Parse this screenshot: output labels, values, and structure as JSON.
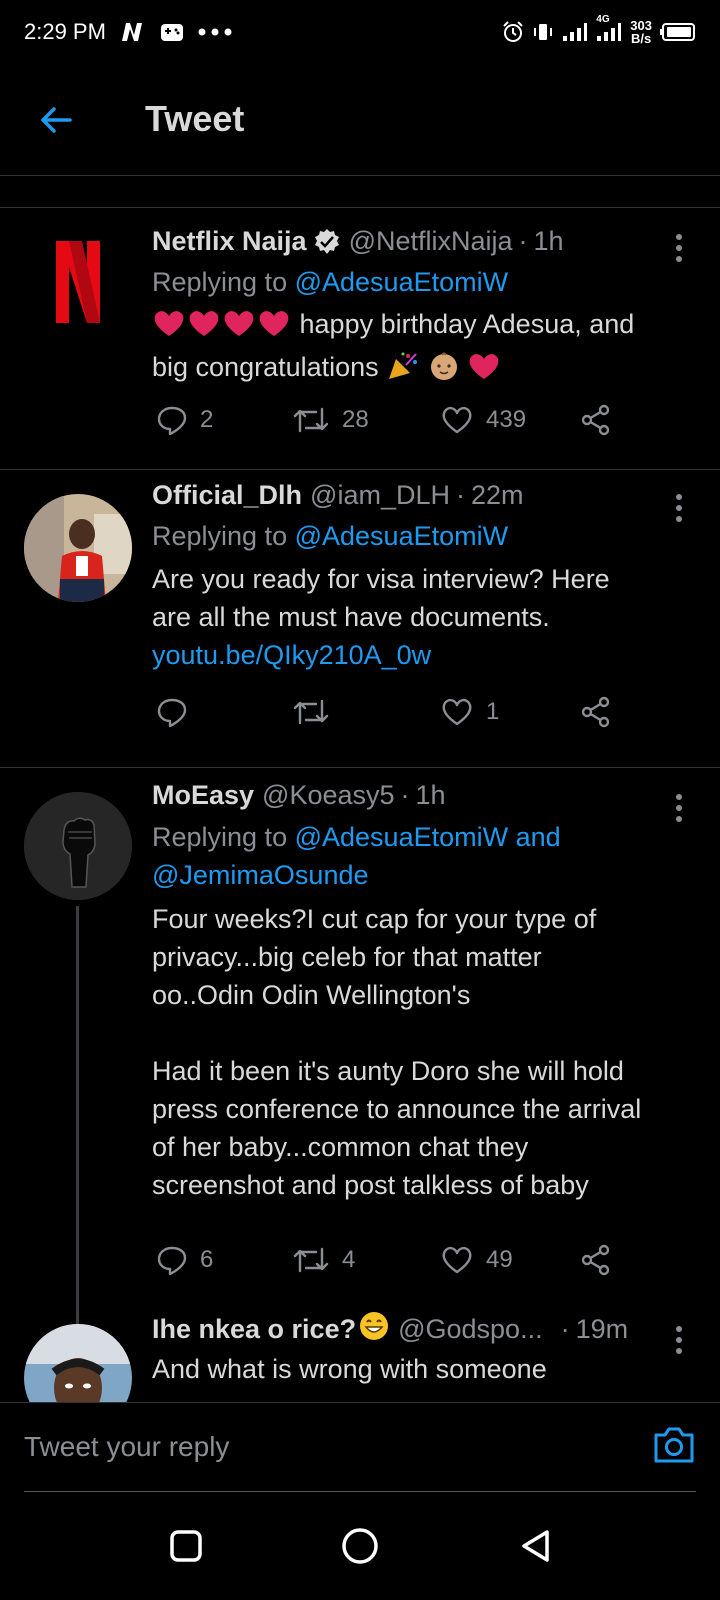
{
  "status_bar": {
    "time": "2:29 PM",
    "net_speed_value": "303",
    "net_speed_unit": "B/s",
    "network_label": "4G"
  },
  "header": {
    "title": "Tweet"
  },
  "tweets": [
    {
      "name": "Netflix Naija",
      "verified": true,
      "handle": "@NetflixNaija",
      "time": "1h",
      "replying_prefix": "Replying to",
      "replying_to": "@AdesuaEtomiW",
      "text_1": "happy birthday Adesua, and",
      "text_2": "big congratulations",
      "replies": "2",
      "retweets": "28",
      "likes": "439"
    },
    {
      "name": "Official_Dlh",
      "handle": "@iam_DLH",
      "time": "22m",
      "replying_prefix": "Replying to",
      "replying_to": "@AdesuaEtomiW",
      "text_1": "Are you ready for visa interview? Here",
      "text_2": "are all the must have documents.",
      "link": "youtu.be/QIky210A_0w",
      "replies": "",
      "retweets": "",
      "likes": "1"
    },
    {
      "name": "MoEasy",
      "handle": "@Koeasy5",
      "time": "1h",
      "replying_prefix": "Replying to",
      "replying_to": "@AdesuaEtomiW and",
      "replying_to_2": "@JemimaOsunde",
      "lines": [
        "Four weeks?I cut cap for your type of",
        "privacy...big celeb for that matter",
        "oo..Odin Odin Wellington's",
        "",
        "Had it been it's aunty Doro she will hold",
        "press conference to announce the arrival",
        "of her baby...common chat they",
        "screenshot and post talkless of baby"
      ],
      "replies": "6",
      "retweets": "4",
      "likes": "49"
    },
    {
      "name": "Ihe nkea o rice?",
      "handle": "@Godspo...",
      "time": "19m",
      "text_1": "And what is wrong with someone"
    }
  ],
  "reply_bar": {
    "placeholder": "Tweet your reply"
  },
  "colors": {
    "accent": "#1d9bf0",
    "like_red": "#e0245e",
    "netflix_red": "#e50914"
  }
}
